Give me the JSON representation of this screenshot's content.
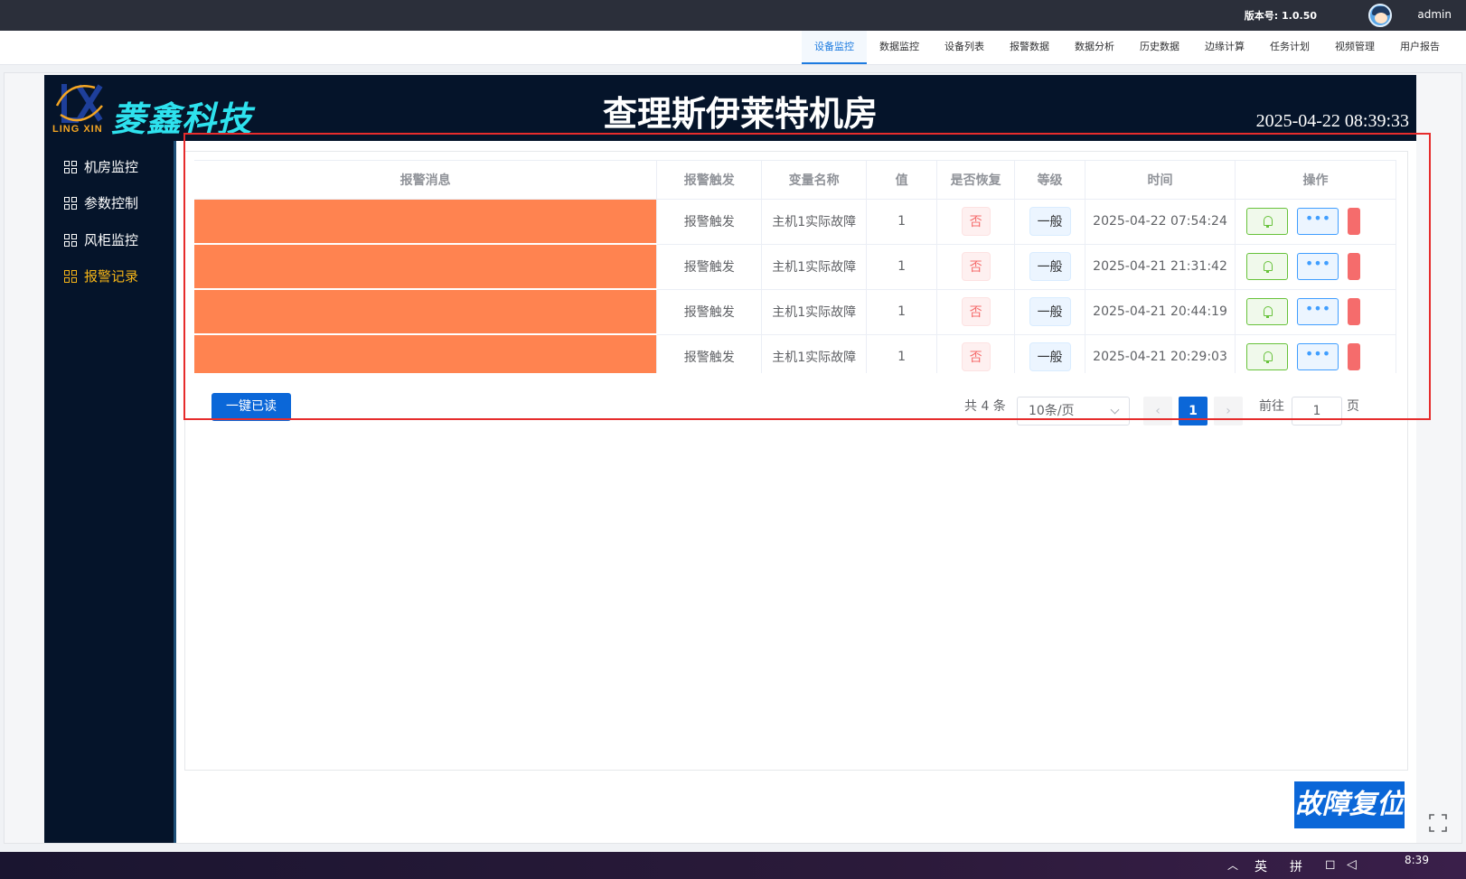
{
  "topbar": {
    "version": "版本号: 1.0.50",
    "user": "admin"
  },
  "menu": {
    "items": [
      "设备监控",
      "数据监控",
      "设备列表",
      "报警数据",
      "数据分析",
      "历史数据",
      "边缘计算",
      "任务计划",
      "视频管理",
      "用户报告"
    ],
    "active": "设备监控"
  },
  "header": {
    "logo_sub": "LING XIN",
    "brand": "菱鑫科技",
    "title": "查理斯伊莱特机房",
    "clock": "2025-04-22 08:39:33"
  },
  "sidebar": {
    "items": [
      "机房监控",
      "参数控制",
      "风柜监控",
      "报警记录"
    ],
    "active": "报警记录"
  },
  "table": {
    "columns": [
      "报警消息",
      "报警触发",
      "变量名称",
      "值",
      "是否恢复",
      "等级",
      "时间",
      "操作"
    ],
    "rows": [
      {
        "trigger": "报警触发",
        "variable": "主机1实际故障",
        "value": "1",
        "recovered": "否",
        "level": "一般",
        "time": "2025-04-22 07:54:24"
      },
      {
        "trigger": "报警触发",
        "variable": "主机1实际故障",
        "value": "1",
        "recovered": "否",
        "level": "一般",
        "time": "2025-04-21 21:31:42"
      },
      {
        "trigger": "报警触发",
        "variable": "主机1实际故障",
        "value": "1",
        "recovered": "否",
        "level": "一般",
        "time": "2025-04-21 20:44:19"
      },
      {
        "trigger": "报警触发",
        "variable": "主机1实际故障",
        "value": "1",
        "recovered": "否",
        "level": "一般",
        "time": "2025-04-21 20:29:03"
      }
    ],
    "more_glyph": "•••"
  },
  "actions": {
    "mark_all_read": "一键已读",
    "fault_reset": "故障复位"
  },
  "pagination": {
    "total": "共 4 条",
    "page_size": "10条/页",
    "prev": "‹",
    "current": "1",
    "next": "›",
    "goto_label": "前往",
    "goto_value": "1",
    "page_unit": "页"
  },
  "taskbar": {
    "ime_1": "英",
    "ime_2": "拼",
    "time": "8:39"
  },
  "colors": {
    "accent": "#0b67d8",
    "alarm": "#ff8350",
    "highlight": "#e62c2c",
    "brand": "#2ee2ee",
    "nav_active": "#f5b417"
  }
}
